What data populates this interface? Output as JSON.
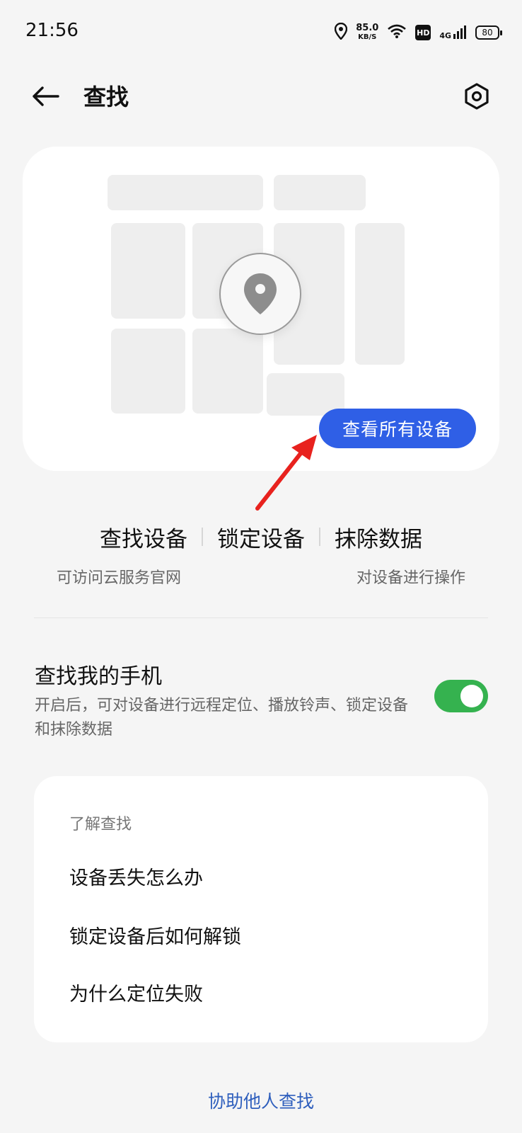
{
  "status_bar": {
    "time": "21:56",
    "speed_value": "85.0",
    "speed_unit": "KB/S",
    "hd_label": "HD",
    "network": "4G",
    "battery": "80"
  },
  "header": {
    "title": "查找"
  },
  "map_card": {
    "view_all_label": "查看所有设备"
  },
  "actions": {
    "find": "查找设备",
    "lock": "锁定设备",
    "erase": "抹除数据",
    "sub_left": "可访问云服务官网",
    "sub_right": "对设备进行操作"
  },
  "find_my_phone": {
    "title": "查找我的手机",
    "description": "开启后，可对设备进行远程定位、播放铃声、锁定设备和抹除数据",
    "enabled": true
  },
  "learn": {
    "title": "了解查找",
    "items": [
      "设备丢失怎么办",
      "锁定设备后如何解锁",
      "为什么定位失败"
    ]
  },
  "footer": {
    "help_link": "协助他人查找"
  },
  "colors": {
    "accent_blue": "#2f5fe6",
    "toggle_green": "#35b24f",
    "link_blue": "#2f5fbd",
    "annotation_red": "#e8221e"
  }
}
